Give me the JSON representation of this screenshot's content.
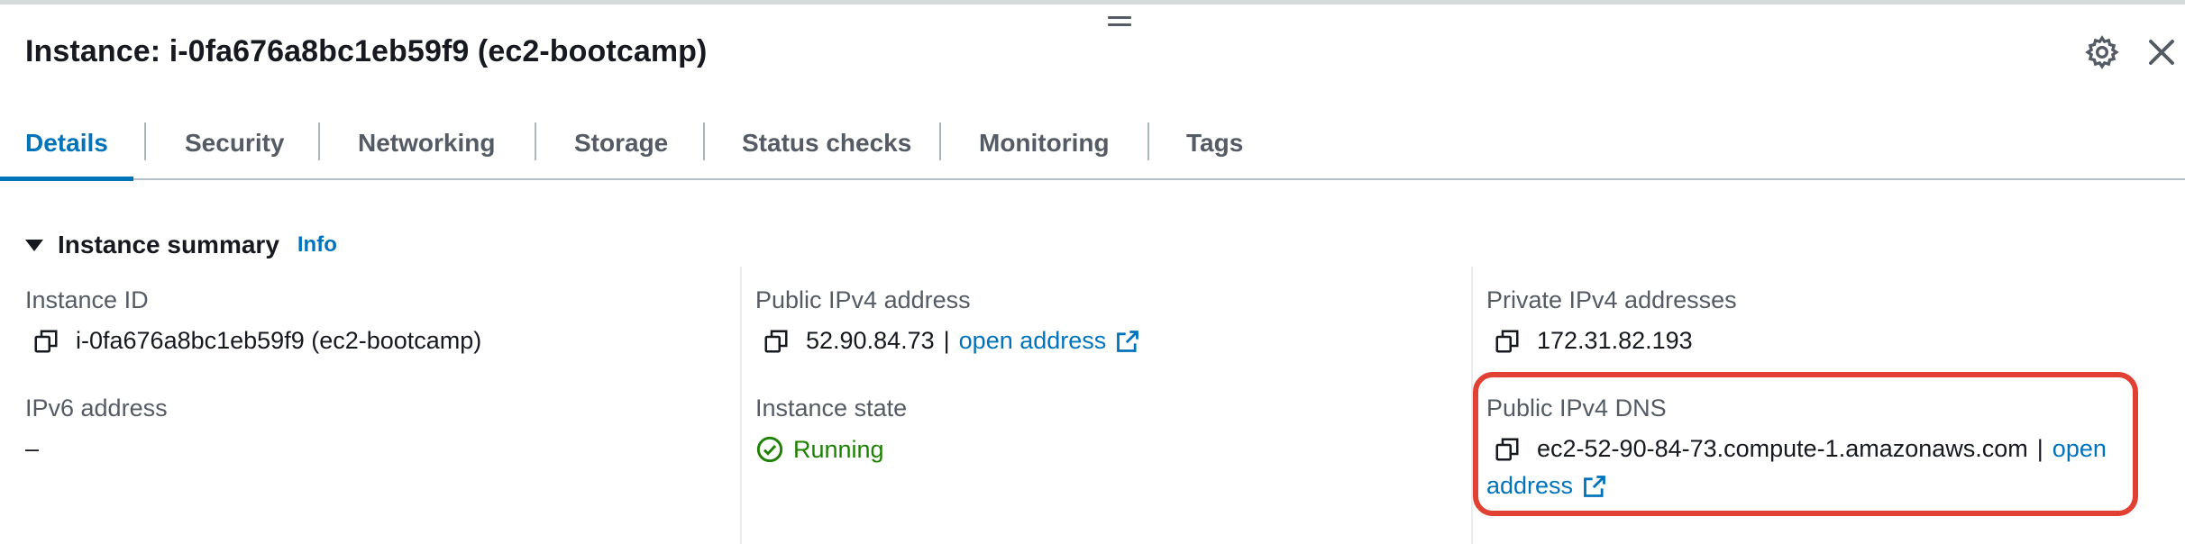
{
  "header": {
    "title": "Instance: i-0fa676a8bc1eb59f9 (ec2-bootcamp)",
    "icons": {
      "settings": "gear-icon",
      "close": "close-icon"
    }
  },
  "tabs": [
    {
      "label": "Details",
      "active": true
    },
    {
      "label": "Security"
    },
    {
      "label": "Networking"
    },
    {
      "label": "Storage"
    },
    {
      "label": "Status checks"
    },
    {
      "label": "Monitoring"
    },
    {
      "label": "Tags"
    }
  ],
  "summary": {
    "title": "Instance summary",
    "info_label": "Info",
    "fields": {
      "instance_id": {
        "label": "Instance ID",
        "value": "i-0fa676a8bc1eb59f9 (ec2-bootcamp)"
      },
      "public_ipv4": {
        "label": "Public IPv4 address",
        "value": "52.90.84.73",
        "separator": "|",
        "link": "open address"
      },
      "private_ipv4": {
        "label": "Private IPv4 addresses",
        "value": "172.31.82.193"
      },
      "ipv6": {
        "label": "IPv6 address",
        "value": "–"
      },
      "instance_state": {
        "label": "Instance state",
        "value": "Running"
      },
      "public_dns": {
        "label": "Public IPv4 DNS",
        "value": "ec2-52-90-84-73.compute-1.amazonaws.com",
        "separator": "|",
        "link_line1": "open",
        "link_line2": "address"
      }
    }
  },
  "colors": {
    "accent": "#0073bb",
    "running": "#1d8102",
    "highlight": "#e04132",
    "text": "#16191f",
    "label": "#545b64"
  }
}
